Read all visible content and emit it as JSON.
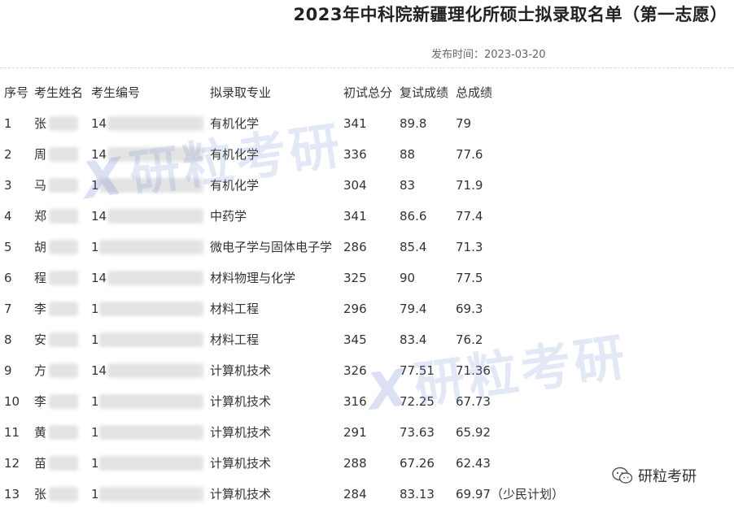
{
  "title": "2023年中科院新疆理化所硕士拟录取名单（第一志愿）",
  "publish_time": "发布时间：2023-03-20",
  "table": {
    "headers": {
      "seq": "序号",
      "name": "考生姓名",
      "id": "考生编号",
      "major": "拟录取专业",
      "initial": "初试总分",
      "retest": "复试成绩",
      "total": "总成绩"
    },
    "rows": [
      {
        "seq": "1",
        "name": "张",
        "id": "14",
        "major": "有机化学",
        "initial": "341",
        "retest": "89.8",
        "total": "79"
      },
      {
        "seq": "2",
        "name": "周",
        "id": "14",
        "major": "有机化学",
        "initial": "336",
        "retest": "88",
        "total": "77.6"
      },
      {
        "seq": "3",
        "name": "马",
        "id": "1",
        "major": "有机化学",
        "initial": "304",
        "retest": "83",
        "total": "71.9"
      },
      {
        "seq": "4",
        "name": "郑",
        "id": "14",
        "major": "中药学",
        "initial": "341",
        "retest": "86.6",
        "total": "77.4"
      },
      {
        "seq": "5",
        "name": "胡",
        "id": "1",
        "major": "微电子学与固体电子学",
        "initial": "286",
        "retest": "85.4",
        "total": "71.3"
      },
      {
        "seq": "6",
        "name": "程",
        "id": "14",
        "major": "材料物理与化学",
        "initial": "325",
        "retest": "90",
        "total": "77.5"
      },
      {
        "seq": "7",
        "name": "李",
        "id": "1",
        "major": "材料工程",
        "initial": "296",
        "retest": "79.4",
        "total": "69.3"
      },
      {
        "seq": "8",
        "name": "安",
        "id": "1",
        "major": "材料工程",
        "initial": "345",
        "retest": "83.4",
        "total": "76.2"
      },
      {
        "seq": "9",
        "name": "方",
        "id": "14",
        "major": "计算机技术",
        "initial": "326",
        "retest": "77.51",
        "total": "71.36"
      },
      {
        "seq": "10",
        "name": "李",
        "id": "1",
        "major": "计算机技术",
        "initial": "316",
        "retest": "72.25",
        "total": "67.73"
      },
      {
        "seq": "11",
        "name": "黄",
        "id": "1",
        "major": "计算机技术",
        "initial": "291",
        "retest": "73.63",
        "total": "65.92"
      },
      {
        "seq": "12",
        "name": "苗",
        "id": "1",
        "major": "计算机技术",
        "initial": "288",
        "retest": "67.26",
        "total": "62.43"
      },
      {
        "seq": "13",
        "name": "张",
        "id": "1",
        "major": "计算机技术",
        "initial": "284",
        "retest": "83.13",
        "total": "69.97（少民计划）"
      }
    ]
  },
  "watermarks": [
    {
      "mark": "X",
      "text": "研粒考研"
    },
    {
      "mark": "X",
      "text": "研粒考研"
    }
  ],
  "wechat": {
    "icon": "wechat-icon",
    "label": "研粒考研"
  }
}
